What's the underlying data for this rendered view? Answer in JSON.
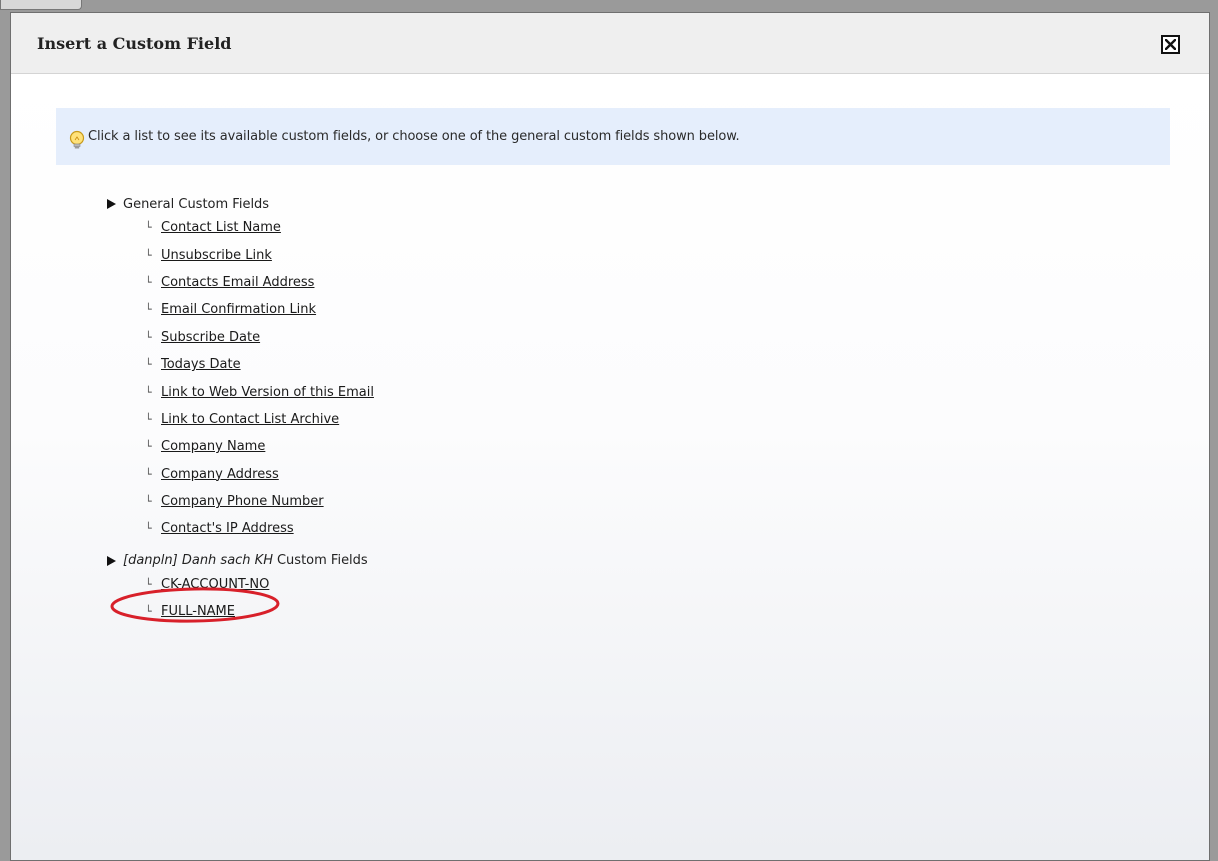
{
  "dialog": {
    "title": "Insert a Custom Field",
    "close_icon": "close-x-icon",
    "hint_icon": "lightbulb-icon",
    "hint_text": "Click a list to see its available custom fields, or choose one of the general custom fields shown below."
  },
  "general": {
    "label": "General Custom Fields",
    "items": [
      "Contact List Name",
      "Unsubscribe Link",
      "Contacts Email Address",
      "Email Confirmation Link",
      "Subscribe Date",
      "Todays Date",
      "Link to Web Version of this Email",
      "Link to Contact List Archive",
      "Company Name",
      "Company Address",
      "Company Phone Number",
      "Contact's IP Address"
    ]
  },
  "list_group": {
    "list_name": "[danpln] Danh sach KH",
    "label": "Custom Fields",
    "items": [
      "CK-ACCOUNT-NO",
      "FULL-NAME"
    ]
  },
  "colors": {
    "hint_background": "#e5eefc",
    "highlight": "#d8202a"
  }
}
